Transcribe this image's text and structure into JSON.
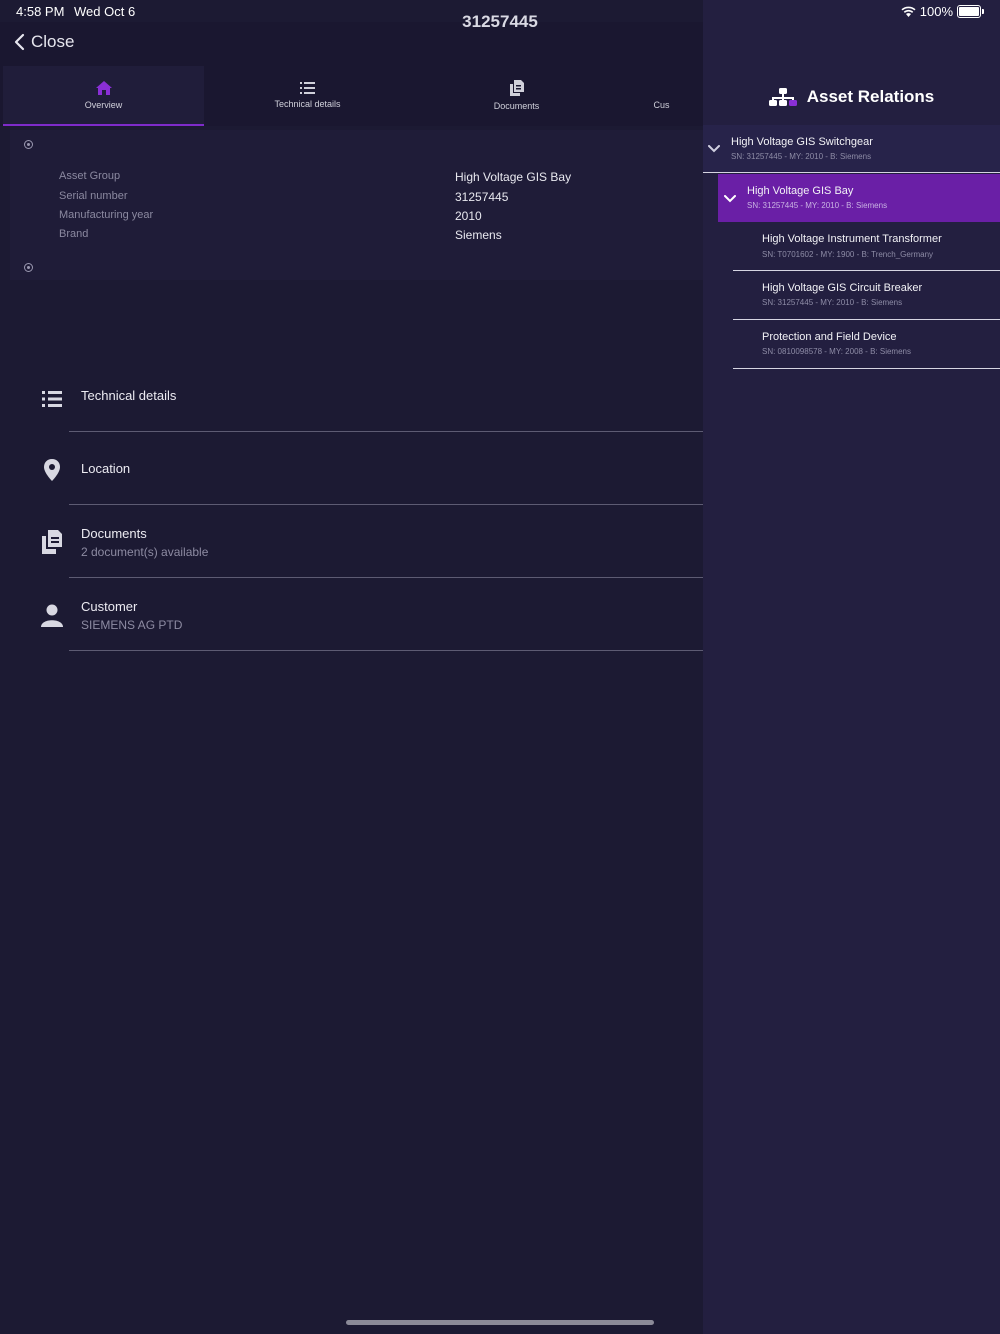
{
  "status_bar": {
    "time": "4:58 PM",
    "date": "Wed Oct 6",
    "battery": "100%"
  },
  "nav": {
    "close_label": "Close",
    "title": "31257445"
  },
  "tabs": [
    {
      "label": "Overview",
      "icon": "home-icon",
      "active": true
    },
    {
      "label": "Technical details",
      "icon": "list-icon",
      "active": false
    },
    {
      "label": "Documents",
      "icon": "documents-icon",
      "active": false
    },
    {
      "label": "Cus",
      "icon": "customer-icon",
      "active": false
    }
  ],
  "overview": {
    "rows": [
      {
        "label": "Asset Group",
        "value": "High Voltage GIS Bay"
      },
      {
        "label": "Serial number",
        "value": "31257445"
      },
      {
        "label": "Manufacturing year",
        "value": "2010"
      },
      {
        "label": "Brand",
        "value": "Siemens"
      }
    ]
  },
  "sections": [
    {
      "title": "Technical details",
      "subtitle": "",
      "icon": "list-icon"
    },
    {
      "title": "Location",
      "subtitle": "",
      "icon": "location-pin-icon"
    },
    {
      "title": "Documents",
      "subtitle": "2 document(s) available",
      "icon": "documents-icon"
    },
    {
      "title": "Customer",
      "subtitle": "SIEMENS AG PTD",
      "icon": "person-icon"
    }
  ],
  "relations": {
    "title": "Asset Relations",
    "items": [
      {
        "name": "High Voltage GIS Switchgear",
        "meta": "SN: 31257445 - MY: 2010 - B: Siemens",
        "level": 0,
        "expanded": true,
        "selected": false
      },
      {
        "name": "High Voltage GIS Bay",
        "meta": "SN: 31257445 - MY: 2010 - B: Siemens",
        "level": 1,
        "expanded": true,
        "selected": true
      },
      {
        "name": "High Voltage Instrument Transformer",
        "meta": "SN: T0701602 - MY: 1900 - B: Trench_Germany",
        "level": 2,
        "expanded": false,
        "selected": false
      },
      {
        "name": "High Voltage GIS Circuit Breaker",
        "meta": "SN: 31257445 - MY: 2010 - B: Siemens",
        "level": 2,
        "expanded": false,
        "selected": false
      },
      {
        "name": "Protection and Field Device",
        "meta": "SN: 0810098578 - MY: 2008 - B: Siemens",
        "level": 2,
        "expanded": false,
        "selected": false
      }
    ]
  },
  "colors": {
    "accent": "#7e2bc9",
    "selected_row": "#6a1fa6",
    "background": "#1c1a33",
    "panel": "#231f40"
  }
}
